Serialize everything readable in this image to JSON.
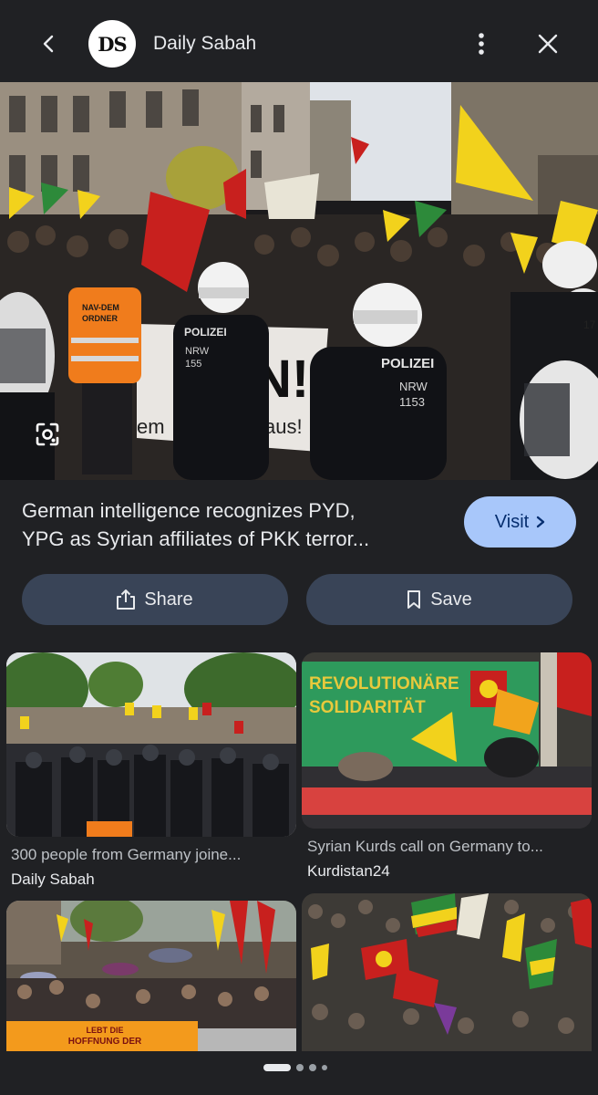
{
  "header": {
    "logo_text": "DS",
    "site_name": "Daily Sabah",
    "icons": [
      "arrow-back-icon",
      "more-vert-icon",
      "close-icon"
    ]
  },
  "result": {
    "title_line1": "German intelligence recognizes PYD,",
    "title_line2": "YPG as Syrian affiliates of PKK terror...",
    "visit_label": "Visit",
    "share_label": "Share",
    "save_label": "Save"
  },
  "hero_image": {
    "description_text": [
      "NAV-DEM ORDNER",
      "POLIZEI",
      "NRW 1153",
      "NRW 155"
    ]
  },
  "related": [
    {
      "caption": "300 people from Germany joine...",
      "source": "Daily Sabah",
      "image_text": []
    },
    {
      "caption": "Syrian Kurds call on Germany to...",
      "source": "Kurdistan24",
      "image_text": [
        "REVOLUTIONÄRE SOLIDARITÄT"
      ]
    },
    {
      "caption": "",
      "source": "",
      "image_text": [
        "LEBT DIE HOFFNUNG DER REVOLUTION!"
      ]
    },
    {
      "caption": "",
      "source": "",
      "image_text": []
    }
  ],
  "pager": {
    "pages": 4,
    "current": 1
  },
  "colors": {
    "background": "#202124",
    "visit_button": "#a8c7fa",
    "pill_button": "#394457",
    "flag_yellow": "#f2d21c",
    "flag_red": "#c8201e",
    "flag_green": "#2d8a3a"
  }
}
